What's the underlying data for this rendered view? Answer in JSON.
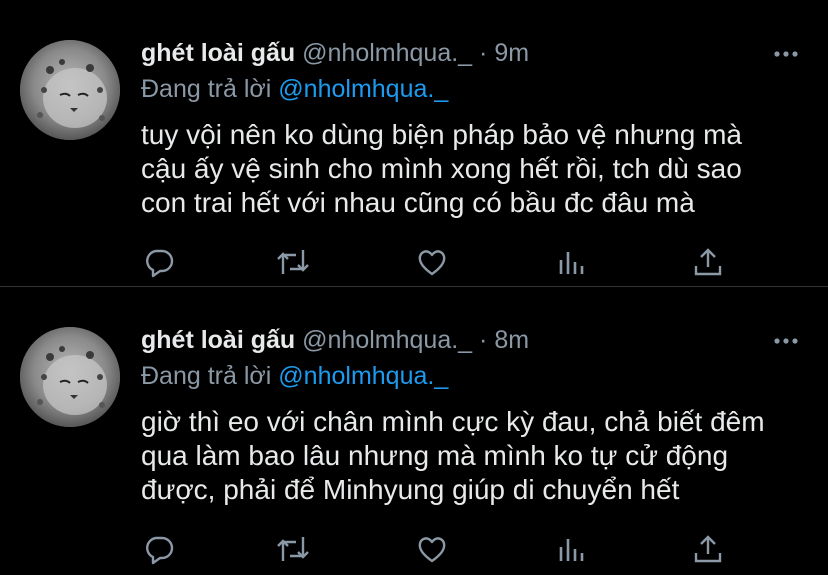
{
  "theme": {
    "background": "#000000",
    "text": "#e7e9ea",
    "muted": "#8b98a5",
    "accent": "#1d9bf0"
  },
  "tweets": [
    {
      "display_name": "ghét loài gấu",
      "handle": "@nholmhqua._",
      "separator": "·",
      "time": "9m",
      "replying_prefix": "Đang trả lời",
      "replying_to": "@nholmhqua._",
      "lines": [
        "tuy vội nên ko dùng biện pháp bảo vệ nhưng mà",
        "cậu ấy vệ sinh cho mình xong hết rồi, tch dù sao",
        "con trai hết với nhau cũng có bầu đc đâu mà"
      ],
      "icons": [
        "reply-icon",
        "retweet-icon",
        "like-icon",
        "analytics-icon",
        "share-icon"
      ]
    },
    {
      "display_name": "ghét loài gấu",
      "handle": "@nholmhqua._",
      "separator": "·",
      "time": "8m",
      "replying_prefix": "Đang trả lời",
      "replying_to": "@nholmhqua._",
      "lines": [
        "giờ thì eo với chân mình cực kỳ đau, chả biết đêm",
        "qua làm bao lâu nhưng mà mình ko tự cử động",
        "được, phải để Minhyung giúp di chuyển hết"
      ],
      "icons": [
        "reply-icon",
        "retweet-icon",
        "like-icon",
        "analytics-icon",
        "share-icon"
      ]
    }
  ]
}
